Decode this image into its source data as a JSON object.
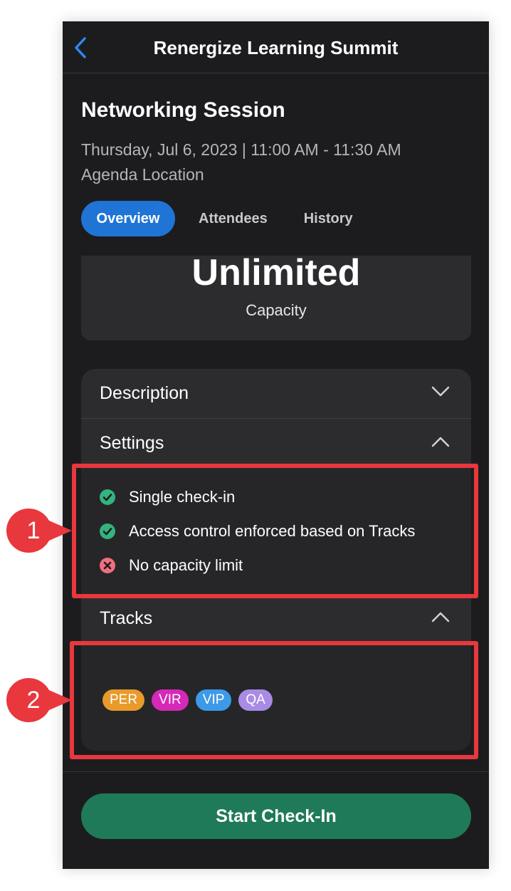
{
  "header": {
    "title": "Renergize Learning Summit",
    "back_icon": "chevron-left-icon"
  },
  "session": {
    "title": "Networking Session",
    "datetime": "Thursday, Jul 6, 2023 | 11:00 AM - 11:30 AM",
    "location": "Agenda Location"
  },
  "tabs": [
    {
      "label": "Overview",
      "active": true
    },
    {
      "label": "Attendees",
      "active": false
    },
    {
      "label": "History",
      "active": false
    }
  ],
  "capacity": {
    "value": "Unlimited",
    "label": "Capacity"
  },
  "sections": {
    "description": {
      "label": "Description",
      "expanded": false
    },
    "settings": {
      "label": "Settings",
      "expanded": true,
      "items": [
        {
          "text": "Single check-in",
          "status": "enabled"
        },
        {
          "text": "Access control enforced based on Tracks",
          "status": "enabled"
        },
        {
          "text": "No capacity limit",
          "status": "disabled"
        }
      ]
    },
    "tracks": {
      "label": "Tracks",
      "expanded": true,
      "chips": [
        {
          "label": "PER",
          "color": "#e89a2a"
        },
        {
          "label": "VIR",
          "color": "#d629b8"
        },
        {
          "label": "VIP",
          "color": "#3d9ae8"
        },
        {
          "label": "QA",
          "color": "#a98be6"
        }
      ]
    }
  },
  "actions": {
    "start_checkin": "Start Check-In"
  },
  "annotations": {
    "callout_1": "1",
    "callout_2": "2"
  },
  "colors": {
    "accent_blue": "#1f74d6",
    "check_green": "#33b37d",
    "error_red": "#ef6f7f",
    "button_green": "#1f7a59",
    "highlight_red": "#e8373d"
  }
}
